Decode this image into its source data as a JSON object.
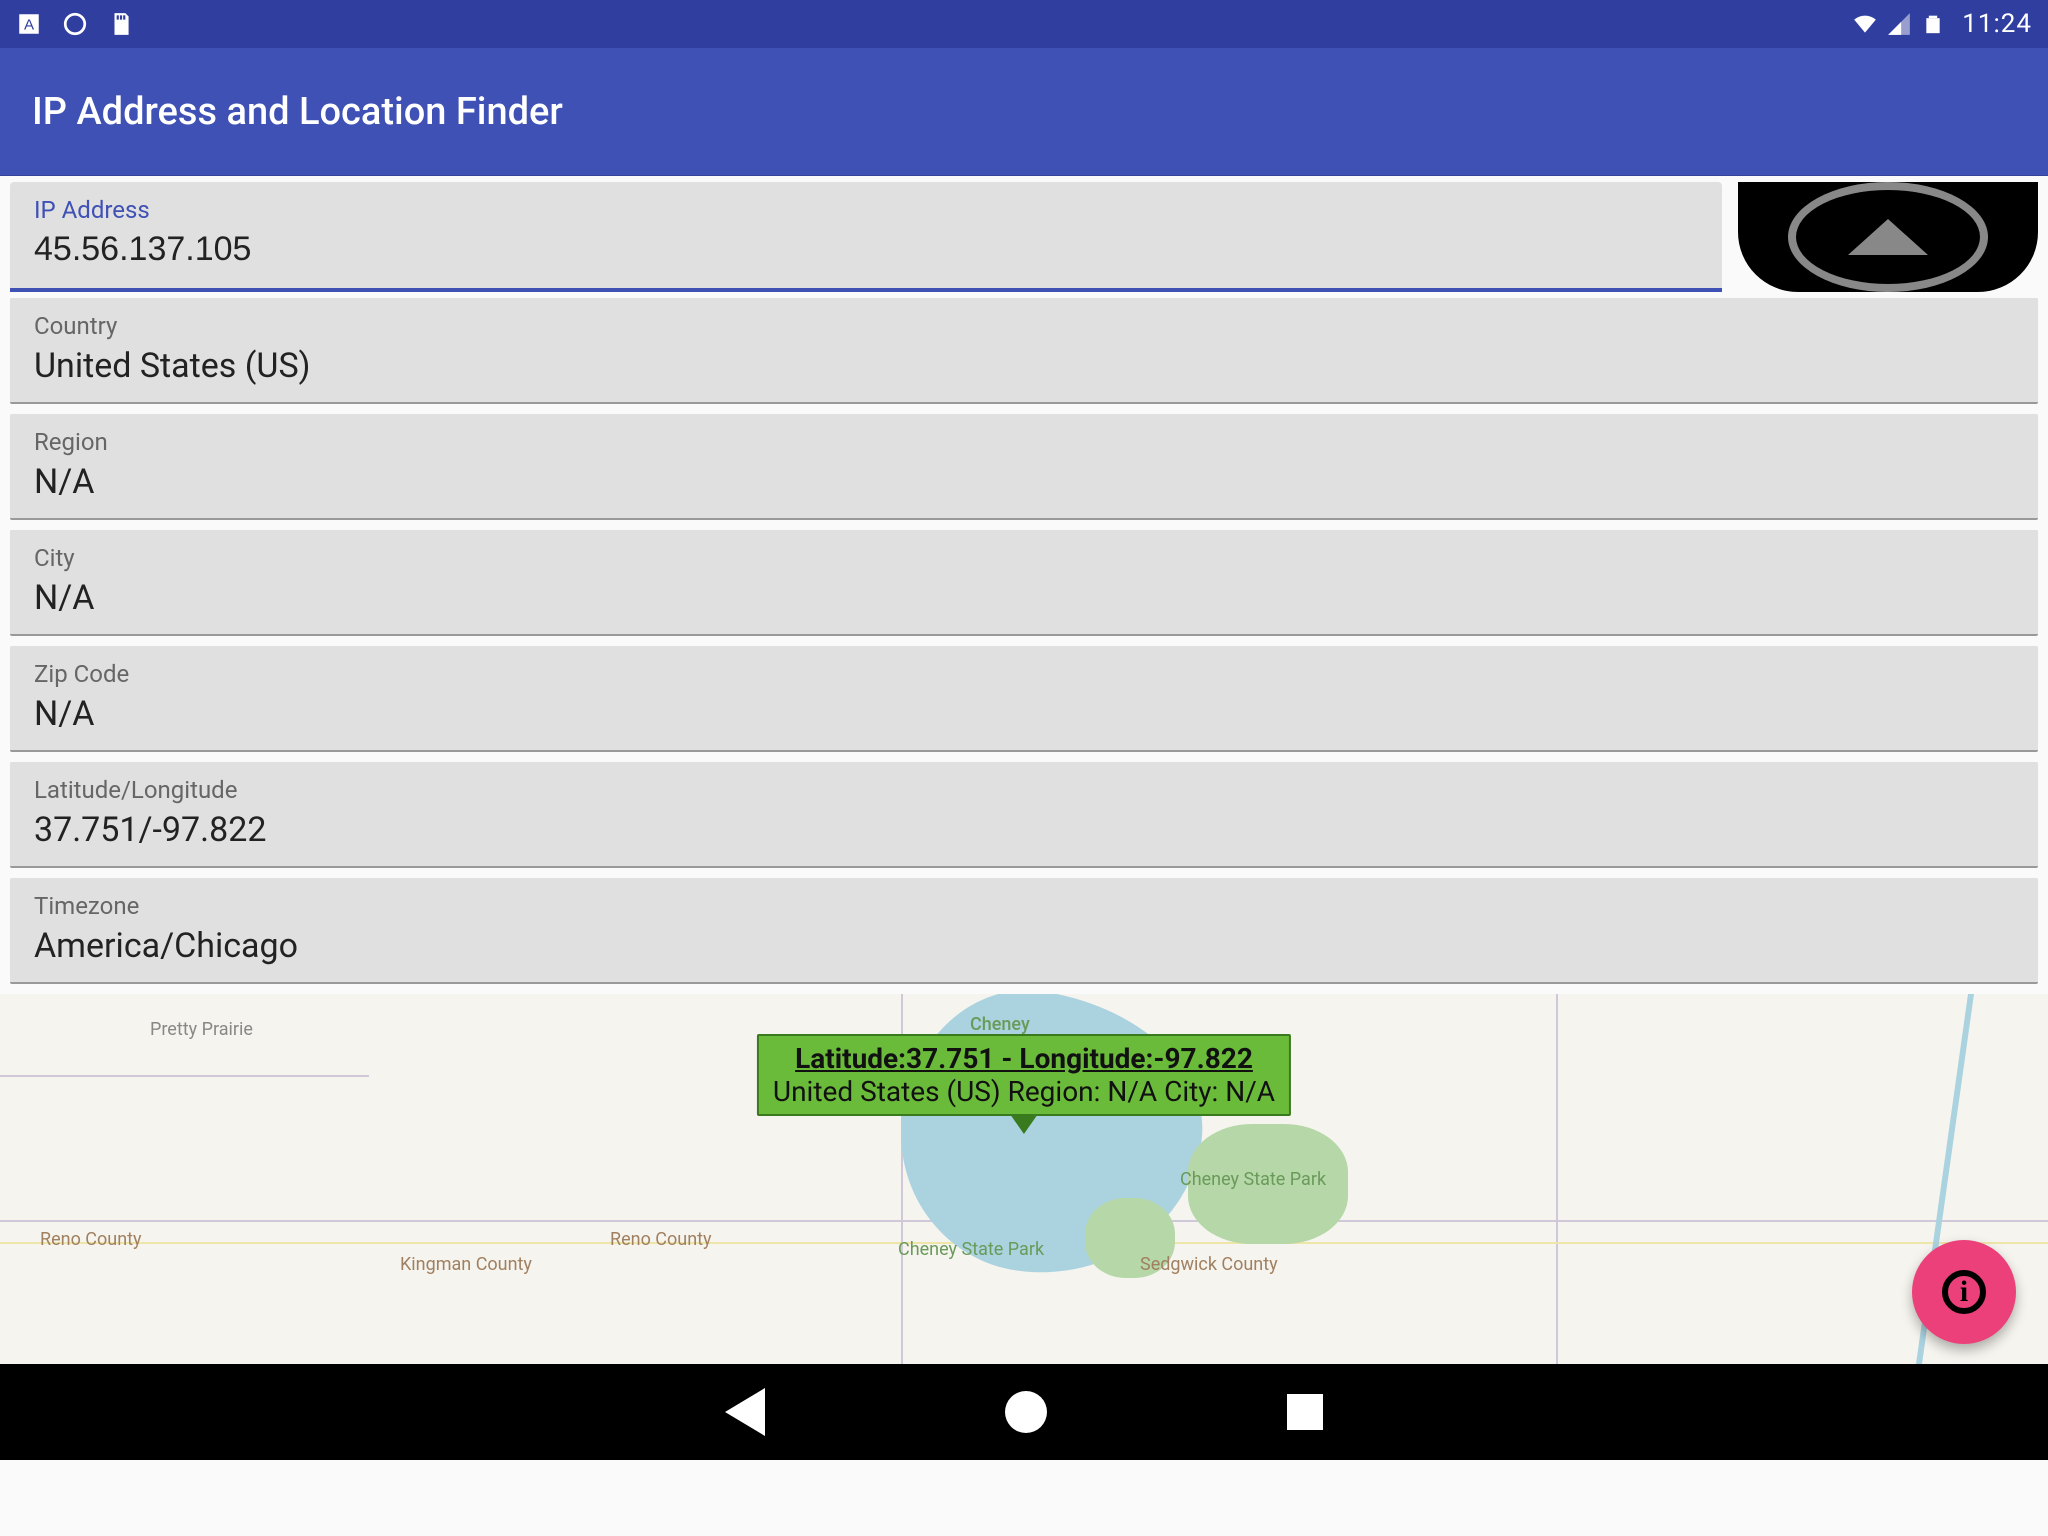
{
  "status": {
    "time": "11:24"
  },
  "appbar": {
    "title": "IP Address and Location Finder"
  },
  "ip": {
    "label": "IP Address",
    "value": "45.56.137.105"
  },
  "fields": {
    "country": {
      "label": "Country",
      "value": "United States (US)"
    },
    "region": {
      "label": "Region",
      "value": "N/A"
    },
    "city": {
      "label": "City",
      "value": "N/A"
    },
    "zip": {
      "label": "Zip Code",
      "value": "N/A"
    },
    "latlon": {
      "label": "Latitude/Longitude",
      "value": "37.751/-97.822"
    },
    "timezone": {
      "label": "Timezone",
      "value": "America/Chicago"
    }
  },
  "map": {
    "callout_title": "Latitude:37.751 - Longitude:-97.822",
    "callout_sub": "United States (US) Region: N/A City: N/A",
    "labels": {
      "pretty_prairie": "Pretty Prairie",
      "cheney_top": "Cheney",
      "cheney_right": "Cheney State Park",
      "cheney_bottom": "Cheney State Park",
      "reno_left": "Reno County",
      "reno_right": "Reno County",
      "kingman": "Kingman County",
      "sedgwick": "Sedgwick County"
    }
  }
}
